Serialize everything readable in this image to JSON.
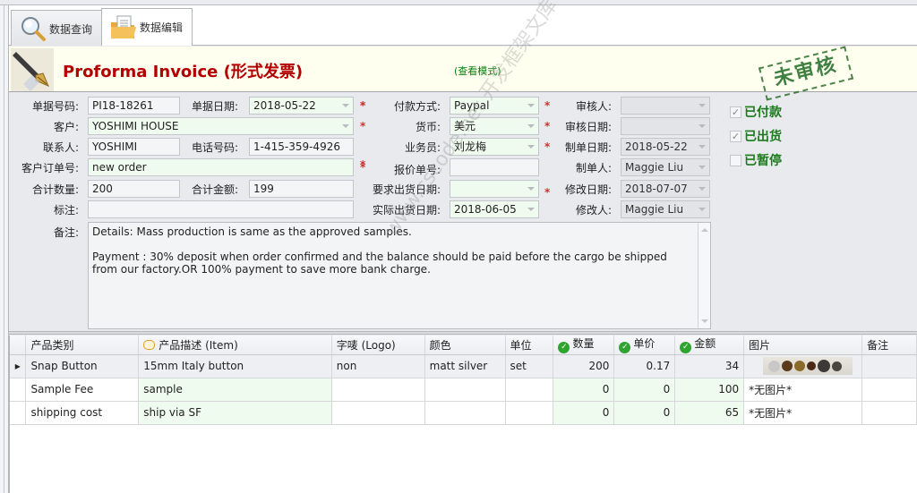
{
  "tabs": [
    {
      "label": "数据查询",
      "icon": "magnifier-icon",
      "active": false
    },
    {
      "label": "数据编辑",
      "icon": "folder-document-icon",
      "active": true
    }
  ],
  "header": {
    "title": "Proforma Invoice (形式发票)",
    "mode": "(查看模式)",
    "stamp": "未审核"
  },
  "form": {
    "doc_no": {
      "label": "单据号码:",
      "value": "PI18-18261"
    },
    "doc_date": {
      "label": "单据日期:",
      "value": "2018-05-22"
    },
    "customer": {
      "label": "客户:",
      "value": "YOSHIMI HOUSE"
    },
    "contact": {
      "label": "联系人:",
      "value": "YOSHIMI"
    },
    "phone": {
      "label": "电话号码:",
      "value": "1-415-359-4926"
    },
    "customer_po": {
      "label": "客户订单号:",
      "value": "new order"
    },
    "total_qty": {
      "label": "合计数量:",
      "value": "200"
    },
    "total_amount": {
      "label": "合计金额:",
      "value": "199"
    },
    "mark": {
      "label": "标注:",
      "value": ""
    },
    "payment_method": {
      "label": "付款方式:",
      "value": "Paypal"
    },
    "currency": {
      "label": "货币:",
      "value": "美元"
    },
    "salesperson": {
      "label": "业务员:",
      "value": "刘龙梅"
    },
    "quote_no": {
      "label": "报价单号:",
      "value": ""
    },
    "required_ship_date": {
      "label": "要求出货日期:",
      "value": ""
    },
    "actual_ship_date": {
      "label": "实际出货日期:",
      "value": "2018-06-05"
    },
    "reviewer": {
      "label": "审核人:",
      "value": ""
    },
    "review_date": {
      "label": "审核日期:",
      "value": ""
    },
    "created_date": {
      "label": "制单日期:",
      "value": "2018-05-22"
    },
    "creator": {
      "label": "制单人:",
      "value": "Maggie Liu"
    },
    "modified_date": {
      "label": "修改日期:",
      "value": "2018-07-07"
    },
    "modifier": {
      "label": "修改人:",
      "value": "Maggie Liu"
    },
    "remarks": {
      "label": "备注:",
      "line1": "Details: Mass production is same as the approved samples.",
      "line2": "Payment : 30% deposit when order confirmed and the balance should be paid before the cargo be shipped from our factory.OR 100% payment to save more bank charge."
    },
    "required_marker": "*"
  },
  "checkboxes": [
    {
      "label": "已付款",
      "checked": true
    },
    {
      "label": "已出货",
      "checked": true
    },
    {
      "label": "已暂停",
      "checked": false
    }
  ],
  "watermark": "www.cscode.net 开发框架文库",
  "grid": {
    "columns": [
      "产品类别",
      "产品描述 (Item)",
      "字唛 (Logo)",
      "颜色",
      "单位",
      "数量",
      "单价",
      "金额",
      "图片",
      "备注"
    ],
    "rows": [
      {
        "category": "Snap Button",
        "item": "15mm Italy button",
        "logo": "non",
        "color": "matt silver",
        "unit": "set",
        "qty": "200",
        "price": "0.17",
        "amount": "34",
        "image": "",
        "note": ""
      },
      {
        "category": "Sample Fee",
        "item": "sample",
        "logo": "",
        "color": "",
        "unit": "",
        "qty": "0",
        "price": "0",
        "amount": "100",
        "image": "*无图片*",
        "note": ""
      },
      {
        "category": "shipping cost",
        "item": "ship via SF",
        "logo": "",
        "color": "",
        "unit": "",
        "qty": "0",
        "price": "0",
        "amount": "65",
        "image": "*无图片*",
        "note": ""
      }
    ]
  },
  "colors": {
    "title_red": "#b20000",
    "status_green": "#1c7a1c",
    "required_bg": "#f0fbf0",
    "required_star": "#d03030"
  }
}
